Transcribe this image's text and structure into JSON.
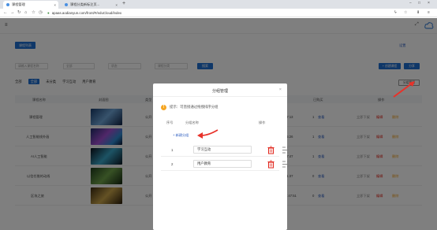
{
  "browser": {
    "active_tab": "课程管理",
    "inactive_tab": "课程分类新标注页...",
    "url": "apaas.aodianyun.com/front/#/eduCloud/index"
  },
  "page": {
    "course_list_button": "课程列表",
    "settings_link": "设置",
    "filters": [
      {
        "placeholder": "请输入课程名称"
      },
      {
        "placeholder": "全部"
      },
      {
        "placeholder": "状态"
      },
      {
        "placeholder": "课程分类"
      }
    ],
    "search_button": "搜索",
    "create_course_button": "+ 创建课程",
    "share_button": "分享",
    "categories": {
      "all": "全部",
      "items": [
        "全部",
        "未分类",
        "学习互动",
        "用户教育"
      ]
    },
    "category_manage_button": "分组管理",
    "table": {
      "headers": [
        "课程名称",
        "封面图",
        "类型",
        "",
        "",
        "已购买",
        "操作"
      ],
      "rows": [
        {
          "name": "课程管理",
          "type": "公开",
          "date": "07:13",
          "sold": "1",
          "unit": "查看",
          "actions": [
            "立即下架",
            "编辑",
            "删除"
          ]
        },
        {
          "name": "人工智能线外画",
          "type": "公开",
          "date": "05:26",
          "sold": "1",
          "unit": "查看",
          "actions": [
            "立即下架",
            "编辑",
            "删除"
          ]
        },
        {
          "name": "AI人工智能",
          "type": "公开",
          "date": "07:47",
          "sold": "1",
          "unit": "查看",
          "actions": [
            "立即下架",
            "编辑",
            "删除"
          ]
        },
        {
          "name": "以信任推的动线",
          "type": "公开",
          "date": "01:37",
          "sold": "0",
          "unit": "查看",
          "actions": [
            "立即下架",
            "编辑",
            "删除"
          ]
        },
        {
          "name": "区块之旅",
          "type": "公开",
          "category": "学习互动",
          "date": "2020-04-29 16:47:51",
          "sold": "0",
          "unit": "查看",
          "actions": [
            "立即下架",
            "编辑",
            "删除"
          ]
        }
      ]
    }
  },
  "modal": {
    "title": "分组管理",
    "tip": "提示：可直接通过拖拽排序分组",
    "headers": {
      "index": "序号",
      "name": "分组名称",
      "action": "操作"
    },
    "add_button": "+ 新建分组",
    "rows": [
      {
        "index": "1",
        "value": "学习互动"
      },
      {
        "index": "2",
        "value": "用户教育"
      }
    ]
  },
  "colors": {
    "primary": "#1f6fd0",
    "danger": "#e1251b",
    "warning": "#f5a623"
  }
}
